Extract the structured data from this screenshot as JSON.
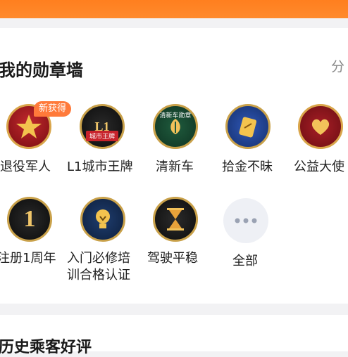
{
  "header": {
    "title": "我的勋章墙",
    "share_label": "分"
  },
  "badges": [
    {
      "label": "退役军人",
      "tag": "新获得",
      "icon": "star-medal-icon"
    },
    {
      "label": "L1城市王牌",
      "emblem_text": "城市王牌",
      "emblem_mark": "L1",
      "icon": "city-ace-medal-icon"
    },
    {
      "label": "清新车",
      "emblem_text": "清新车勋章",
      "icon": "fresh-car-medal-icon"
    },
    {
      "label": "拾金不昧",
      "icon": "wallet-return-medal-icon"
    },
    {
      "label": "公益大使",
      "icon": "heart-medal-icon"
    },
    {
      "label": "注册1周年",
      "emblem_mark": "1",
      "icon": "anniversary-medal-icon"
    },
    {
      "label_line1": "入门必修培",
      "label_line2": "训合格认证",
      "icon": "training-medal-icon"
    },
    {
      "label": "驾驶平稳",
      "icon": "hourglass-medal-icon"
    },
    {
      "label": "全部",
      "icon": "more-dots-icon"
    }
  ],
  "history": {
    "title": "历史乘客好评"
  },
  "colors": {
    "accent": "#ff7f1f",
    "tag": "#ff7a3a"
  }
}
